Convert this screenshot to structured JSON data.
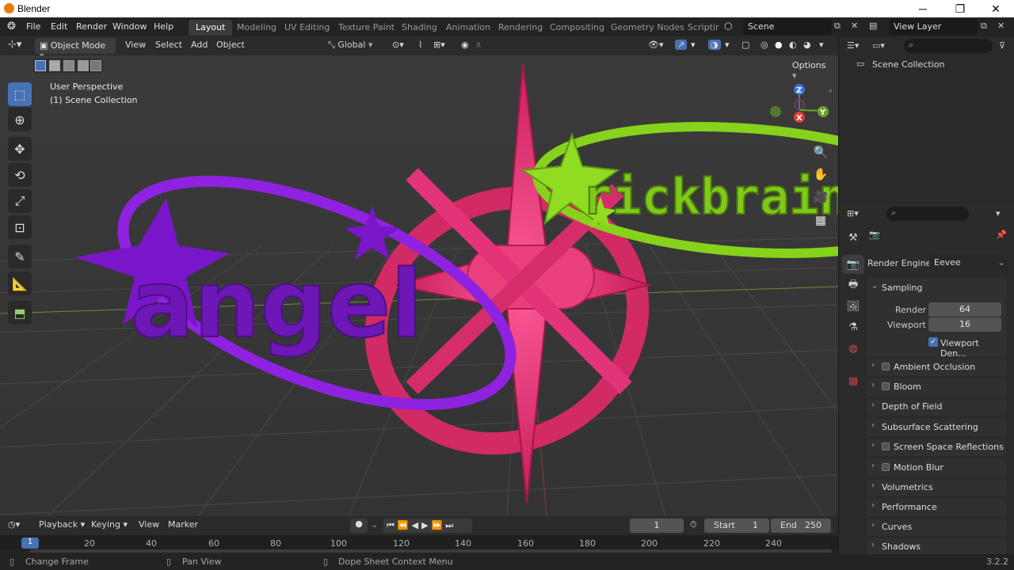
{
  "window": {
    "title": "Blender",
    "minimize": "─",
    "maximize": "❐",
    "close": "✕"
  },
  "menu": {
    "items": [
      "File",
      "Edit",
      "Render",
      "Window",
      "Help"
    ]
  },
  "workspace_tabs": [
    "Layout",
    "Modeling",
    "UV Editing",
    "Texture Paint",
    "Shading",
    "Animation",
    "Rendering",
    "Compositing",
    "Geometry Nodes",
    "Scriptir"
  ],
  "scene": {
    "name": "Scene"
  },
  "view_layer": {
    "name": "View Layer"
  },
  "viewport_header": {
    "mode": "Object Mode",
    "menus": [
      "View",
      "Select",
      "Add",
      "Object"
    ],
    "orientation": "Global",
    "options": "Options"
  },
  "viewport": {
    "perspective": "User Perspective",
    "collection": "(1) Scene Collection",
    "text_angel": "angel",
    "text_brain": "rickbrain",
    "gizmo": {
      "x": "X",
      "y": "Y",
      "z": "Z"
    }
  },
  "outliner": {
    "root": "Scene Collection"
  },
  "properties": {
    "render_engine_label": "Render Engine",
    "render_engine_value": "Eevee",
    "sampling": {
      "title": "Sampling",
      "render_label": "Render",
      "render_value": 64,
      "viewport_label": "Viewport",
      "viewport_value": 16,
      "denoise_label": "Viewport Den..."
    },
    "panels": [
      "Ambient Occlusion",
      "Bloom",
      "Depth of Field",
      "Subsurface Scattering",
      "Screen Space Reflections",
      "Motion Blur",
      "Volumetrics",
      "Performance",
      "Curves",
      "Shadows"
    ],
    "panel_checkboxes": [
      true,
      true,
      false,
      false,
      true,
      true,
      false,
      false,
      false,
      false
    ]
  },
  "timeline": {
    "menus": [
      "Playback",
      "Keying",
      "View",
      "Marker"
    ],
    "current_frame": 1,
    "start_label": "Start",
    "start": 1,
    "end_label": "End",
    "end": 250,
    "ticks": [
      1,
      20,
      40,
      60,
      80,
      100,
      120,
      140,
      160,
      180,
      200,
      220,
      240
    ]
  },
  "status": {
    "left": "Change Frame",
    "middle": "Pan View",
    "right": "Dope Sheet Context Menu",
    "version": "3.2.2"
  },
  "colors": {
    "accent": "#4772b3",
    "purple": "#7a16c9",
    "pink": "#e0306f",
    "green": "#8fdc22",
    "grid": "#474747"
  }
}
